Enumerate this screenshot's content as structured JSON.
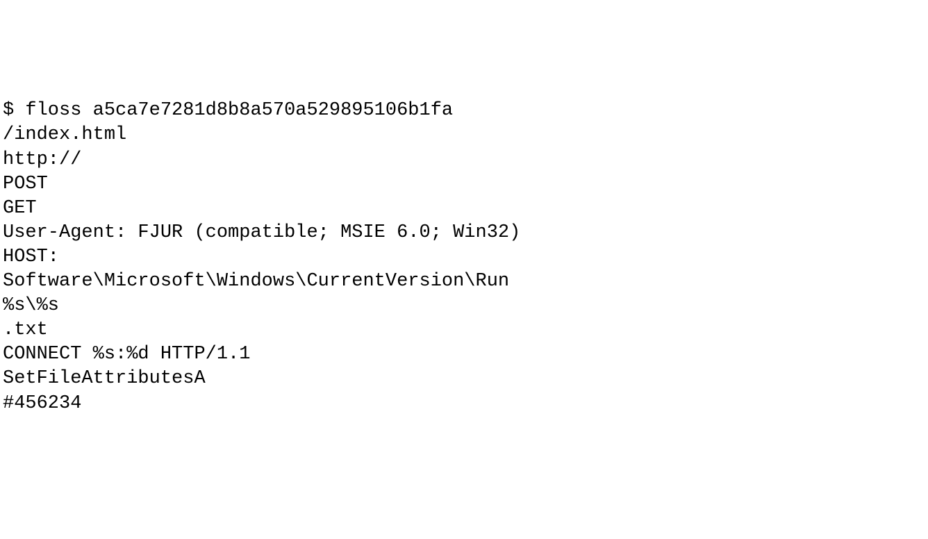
{
  "terminal": {
    "lines": [
      "$ floss a5ca7e7281d8b8a570a529895106b1fa",
      "/index.html",
      "http://",
      "POST",
      "GET",
      "User-Agent: FJUR (compatible; MSIE 6.0; Win32)",
      "HOST:",
      "Software\\Microsoft\\Windows\\CurrentVersion\\Run",
      "%s\\%s",
      ".txt",
      "CONNECT %s:%d HTTP/1.1",
      "SetFileAttributesA",
      "#456234"
    ]
  }
}
